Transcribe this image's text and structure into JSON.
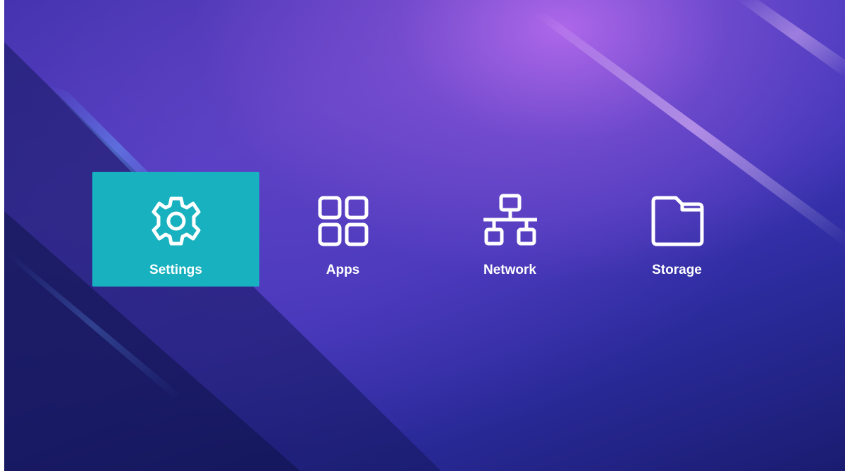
{
  "menu": {
    "items": [
      {
        "label": "Settings",
        "icon": "gear-icon",
        "selected": true
      },
      {
        "label": "Apps",
        "icon": "grid-icon",
        "selected": false
      },
      {
        "label": "Network",
        "icon": "network-icon",
        "selected": false
      },
      {
        "label": "Storage",
        "icon": "folder-icon",
        "selected": false
      }
    ]
  },
  "colors": {
    "selected_tile": "#17b1bf",
    "text": "#ffffff",
    "background_top": "#b46ee6",
    "background_bottom": "#1a1c70"
  }
}
